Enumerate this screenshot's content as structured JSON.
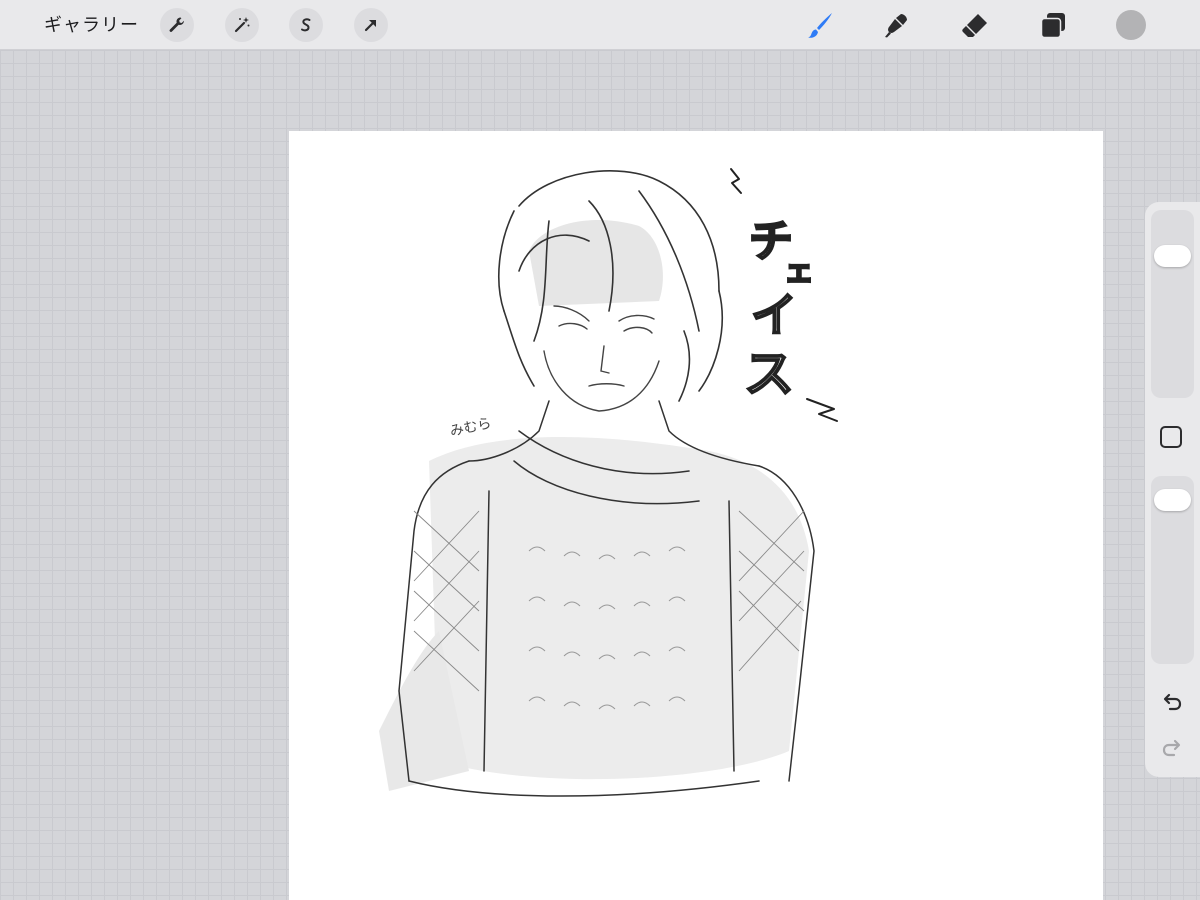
{
  "toolbar": {
    "gallery_label": "ギャラリー",
    "actions": [
      {
        "name": "actions-wrench-icon"
      },
      {
        "name": "adjustments-magic-wand-icon"
      },
      {
        "name": "selection-icon"
      },
      {
        "name": "transform-arrow-icon"
      }
    ],
    "tools": [
      {
        "name": "brush-icon",
        "active": true
      },
      {
        "name": "smudge-icon",
        "active": false
      },
      {
        "name": "eraser-icon",
        "active": false
      },
      {
        "name": "layers-icon",
        "active": false
      }
    ],
    "active_color": "#b3b3b5",
    "accent_color": "#2f7cf6"
  },
  "canvas": {
    "sketch_text": [
      "チ",
      "ェ",
      "イ",
      "ス"
    ],
    "signature_text": "みむら"
  },
  "sidebar": {
    "brush_size_level": 0.2,
    "opacity_level": 0.06,
    "modifier_icon": "square-modifier-icon",
    "undo_icon": "undo-icon",
    "redo_icon": "redo-icon"
  }
}
